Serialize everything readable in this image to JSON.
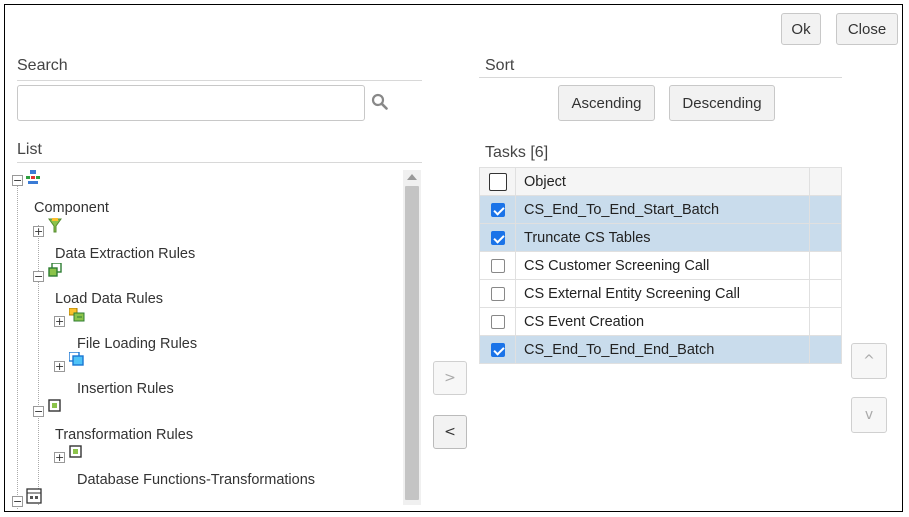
{
  "header": {
    "ok_label": "Ok",
    "close_label": "Close"
  },
  "search": {
    "label": "Search",
    "value": "",
    "placeholder": ""
  },
  "sort": {
    "label": "Sort",
    "ascending_label": "Ascending",
    "descending_label": "Descending"
  },
  "list": {
    "label": "List",
    "tree": [
      {
        "label": "Component",
        "toggle": "+",
        "icon": "funnel-icon"
      },
      {
        "label": "Data Extraction Rules",
        "toggle": "−",
        "icon": "db-rules-icon"
      },
      {
        "label": "Load Data Rules",
        "toggle": "+",
        "icon": "load-rules-icon"
      },
      {
        "label": "File Loading Rules",
        "toggle": "+",
        "icon": "file-loading-icon"
      },
      {
        "label": "Insertion Rules",
        "toggle": "−",
        "icon": "insertion-icon"
      },
      {
        "label": "Transformation Rules",
        "toggle": "+",
        "icon": "transformation-icon"
      },
      {
        "label": "Database Functions-Transformations",
        "toggle": "−",
        "icon": "db-functions-icon"
      }
    ]
  },
  "tasks": {
    "label": "Tasks [6]",
    "header": "Object",
    "rows": [
      {
        "name": "CS_End_To_End_Start_Batch",
        "checked": true
      },
      {
        "name": "Truncate CS Tables",
        "checked": true
      },
      {
        "name": "CS Customer Screening Call",
        "checked": false
      },
      {
        "name": "CS External Entity Screening Call",
        "checked": false
      },
      {
        "name": "CS Event Creation",
        "checked": false
      },
      {
        "name": "CS_End_To_End_End_Batch",
        "checked": true
      }
    ]
  },
  "transfer": {
    "add_glyph": ">",
    "remove_glyph": "<"
  },
  "reorder": {
    "up_glyph": "^",
    "down_glyph": "v"
  },
  "colors": {
    "selected_row": "#c9dcec",
    "checkbox": "#1a73e8"
  }
}
